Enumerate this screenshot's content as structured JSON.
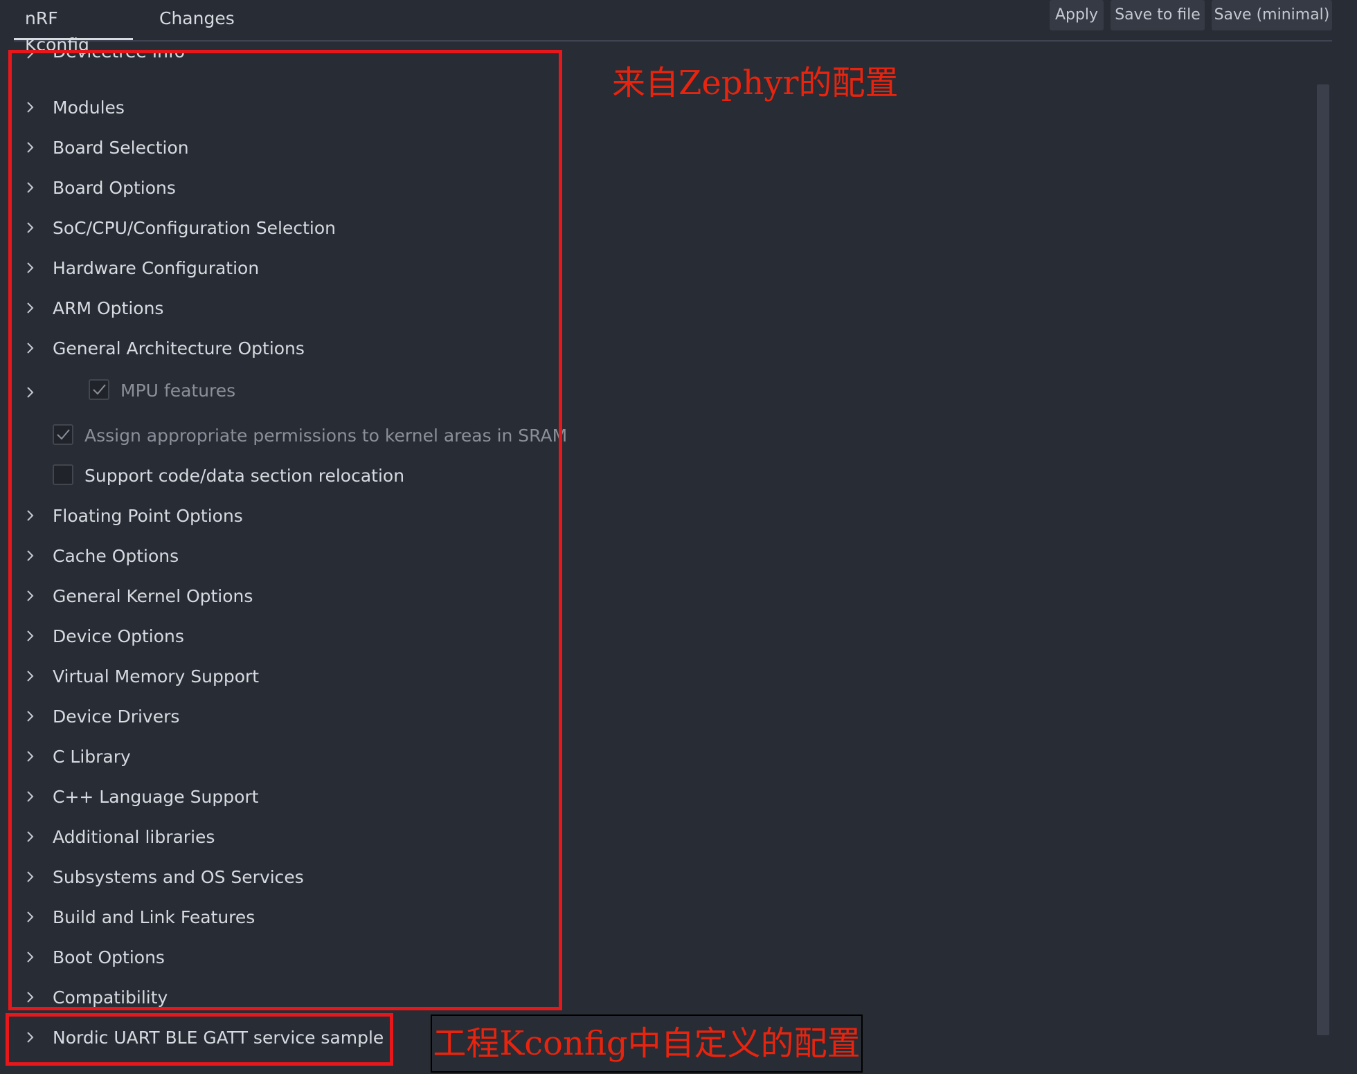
{
  "tabs": [
    {
      "label": "nRF Kconfig",
      "active": true
    },
    {
      "label": "Changes",
      "active": false
    }
  ],
  "actions": {
    "apply": "Apply",
    "save_to_file": "Save to file",
    "save_minimal": "Save (minimal)"
  },
  "tree": {
    "items": [
      {
        "label": "Devicetree Info",
        "type": "menu"
      },
      {
        "label": "Modules",
        "type": "menu"
      },
      {
        "label": "Board Selection",
        "type": "menu"
      },
      {
        "label": "Board Options",
        "type": "menu"
      },
      {
        "label": "SoC/CPU/Configuration Selection",
        "type": "menu"
      },
      {
        "label": "Hardware Configuration",
        "type": "menu"
      },
      {
        "label": "ARM Options",
        "type": "menu"
      },
      {
        "label": "General Architecture Options",
        "type": "menu"
      },
      {
        "label": "MPU features",
        "type": "menu-checkbox",
        "checked": true,
        "disabled": true
      },
      {
        "label": "Assign appropriate permissions to kernel areas in SRAM",
        "type": "checkbox",
        "checked": true,
        "disabled": true
      },
      {
        "label": "Support code/data section relocation",
        "type": "checkbox",
        "checked": false,
        "disabled": false
      },
      {
        "label": "Floating Point Options",
        "type": "menu"
      },
      {
        "label": "Cache Options",
        "type": "menu"
      },
      {
        "label": "General Kernel Options",
        "type": "menu"
      },
      {
        "label": "Device Options",
        "type": "menu"
      },
      {
        "label": "Virtual Memory Support",
        "type": "menu"
      },
      {
        "label": "Device Drivers",
        "type": "menu"
      },
      {
        "label": "C Library",
        "type": "menu"
      },
      {
        "label": "C++ Language Support",
        "type": "menu"
      },
      {
        "label": "Additional libraries",
        "type": "menu"
      },
      {
        "label": "Subsystems and OS Services",
        "type": "menu"
      },
      {
        "label": "Build and Link Features",
        "type": "menu"
      },
      {
        "label": "Boot Options",
        "type": "menu"
      },
      {
        "label": "Compatibility",
        "type": "menu"
      },
      {
        "label": "Nordic UART BLE GATT service sample",
        "type": "menu"
      }
    ]
  },
  "annotations": {
    "zephyr_config": "来自Zephyr的配置",
    "project_config": "工程Kconfig中自定义的配置",
    "color": "#e8240f"
  },
  "icons": {
    "expand": "chevron-right-icon",
    "check": "checkmark-icon"
  }
}
